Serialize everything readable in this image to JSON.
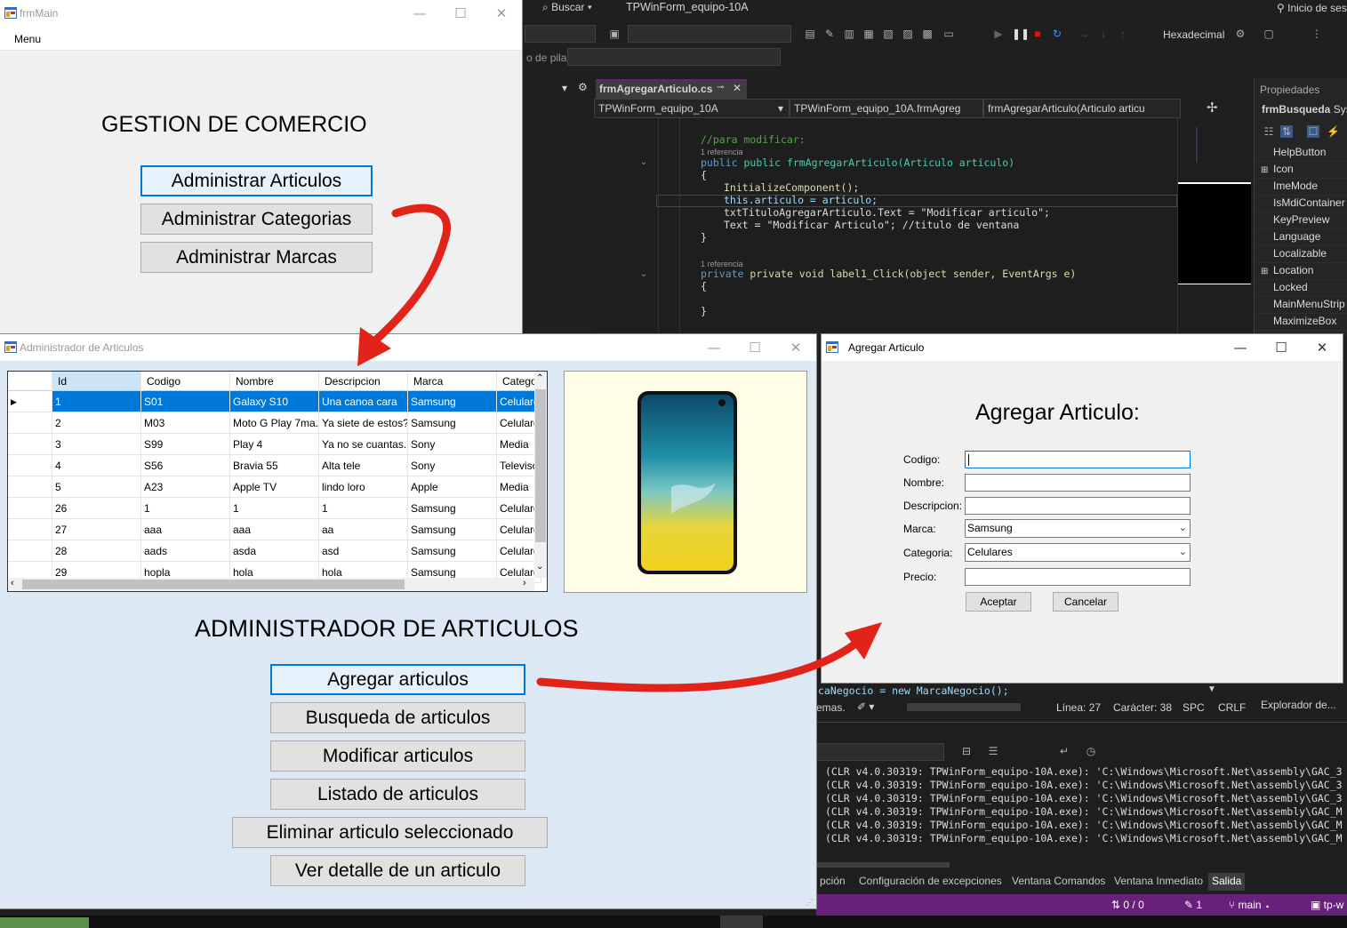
{
  "vs": {
    "search_label": "Buscar",
    "solution_name": "TPWinForm_equipo-10A",
    "start_label": "Inicio de ses",
    "hex_label": "Hexadecimal",
    "stack_label": "o de pila:",
    "editor_tab": "frmAgregarArticulo.cs",
    "nav_project": "TPWinForm_equipo_10A",
    "nav_class": "TPWinForm_equipo_10A.frmAgreg",
    "nav_member": "frmAgregarArticulo(Articulo articu",
    "code": {
      "comment_modify": "//para modificar:",
      "ref1": "1 referencia",
      "ctor_sig": "public frmAgregarArticulo(Articulo articulo)",
      "brace_open": "{",
      "init": "InitializeComponent();",
      "assign": "this.articulo = articulo;",
      "title_assign": "txtTituloAgregarArticulo.Text = \"Modificar articulo\";",
      "text_assign": "Text = \"Modificar Articulo\"; //titulo de ventana",
      "brace_close": "}",
      "ref2": "1 referencia",
      "click_sig": "private void label1_Click(object sender, EventArgs e)",
      "brace_open2": "{",
      "brace_close2": "}",
      "bottom_line": "caNegocio = new MarcaNegocio();"
    },
    "status": {
      "schemes": "emas.",
      "line": "Línea: 27",
      "char": "Carácter: 38",
      "spc": "SPC",
      "crlf": "CRLF"
    },
    "properties": {
      "title": "Propiedades",
      "object": "frmBusqueda",
      "object_type": "Sys",
      "rows": [
        "HelpButton",
        "Icon",
        "ImeMode",
        "IsMdiContainer",
        "KeyPreview",
        "Language",
        "Localizable",
        "Location",
        "Locked",
        "MainMenuStrip",
        "MaximizeBox"
      ],
      "explorer": "Explorador de..."
    },
    "output_lines": [
      "(CLR v4.0.30319: TPWinForm_equipo-10A.exe): 'C:\\Windows\\Microsoft.Net\\assembly\\GAC_3",
      "(CLR v4.0.30319: TPWinForm_equipo-10A.exe): 'C:\\Windows\\Microsoft.Net\\assembly\\GAC_3",
      "(CLR v4.0.30319: TPWinForm_equipo-10A.exe): 'C:\\Windows\\Microsoft.Net\\assembly\\GAC_3",
      "(CLR v4.0.30319: TPWinForm_equipo-10A.exe): 'C:\\Windows\\Microsoft.Net\\assembly\\GAC_M",
      "(CLR v4.0.30319: TPWinForm_equipo-10A.exe): 'C:\\Windows\\Microsoft.Net\\assembly\\GAC_M",
      "(CLR v4.0.30319: TPWinForm_equipo-10A.exe): 'C:\\Windows\\Microsoft.Net\\assembly\\GAC_M"
    ],
    "bottom_tabs": [
      "pción",
      "Configuración de excepciones",
      "Ventana Comandos",
      "Ventana Inmediato",
      "Salida"
    ],
    "git": {
      "sync": "0 / 0",
      "changes": "1",
      "branch": "main",
      "repo": "tp-w"
    }
  },
  "frm_main": {
    "title": "frmMain",
    "menu": "Menu",
    "heading": "GESTION DE COMERCIO",
    "buttons": [
      "Administrar Articulos",
      "Administrar Categorias",
      "Administrar Marcas"
    ]
  },
  "frm_admin": {
    "title": "Administrador de Articulos",
    "heading": "ADMINISTRADOR DE ARTICULOS",
    "grid": {
      "columns": [
        "Id",
        "Codigo",
        "Nombre",
        "Descripcion",
        "Marca",
        "Catego"
      ],
      "rows": [
        [
          "1",
          "S01",
          "Galaxy S10",
          "Una canoa cara",
          "Samsung",
          "Celulare"
        ],
        [
          "2",
          "M03",
          "Moto G Play 7ma...",
          "Ya siete de estos?",
          "Samsung",
          "Celulare"
        ],
        [
          "3",
          "S99",
          "Play 4",
          "Ya no se cuantas...",
          "Sony",
          "Media"
        ],
        [
          "4",
          "S56",
          "Bravia 55",
          "Alta tele",
          "Sony",
          "Televisc"
        ],
        [
          "5",
          "A23",
          "Apple TV",
          "lindo loro",
          "Apple",
          "Media"
        ],
        [
          "26",
          "1",
          "1",
          "1",
          "Samsung",
          "Celulare"
        ],
        [
          "27",
          "aaa",
          "aaa",
          "aa",
          "Samsung",
          "Celulare"
        ],
        [
          "28",
          "aads",
          "asda",
          "asd",
          "Samsung",
          "Celulare"
        ],
        [
          "29",
          "hopla",
          "hola",
          "hola",
          "Samsung",
          "Celulare"
        ]
      ],
      "selected_row": 0
    },
    "buttons": [
      "Agregar articulos",
      "Busqueda de articulos",
      "Modificar articulos",
      "Listado de articulos",
      "Eliminar articulo seleccionado",
      "Ver detalle de un articulo"
    ]
  },
  "frm_agregar": {
    "title": "Agregar Articulo",
    "heading": "Agregar Articulo:",
    "labels": {
      "codigo": "Codigo:",
      "nombre": "Nombre:",
      "descripcion": "Descripcion:",
      "marca": "Marca:",
      "categoria": "Categoria:",
      "precio": "Precio:"
    },
    "values": {
      "codigo": "",
      "nombre": "",
      "descripcion": "",
      "marca": "Samsung",
      "categoria": "Celulares",
      "precio": ""
    },
    "accept": "Aceptar",
    "cancel": "Cancelar"
  },
  "colors": {
    "arrow": "#e2231a",
    "accent": "#0078d7",
    "admin_bg": "#dce8f3"
  }
}
